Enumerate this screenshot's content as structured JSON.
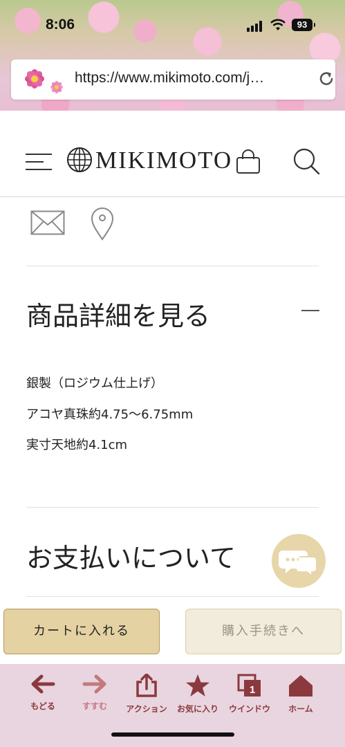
{
  "status_bar": {
    "time": "8:06",
    "battery": "93"
  },
  "browser": {
    "url": "https://www.mikimoto.com/j…"
  },
  "site": {
    "logo_text": "MIKIMOTO"
  },
  "product_detail": {
    "title": "商品詳細を見る",
    "lines": [
      "銀製（ロジウム仕上げ）",
      "アコヤ真珠約4.75〜6.75mm",
      "実寸天地約4.1cm"
    ]
  },
  "payment": {
    "title": "お支払いについて"
  },
  "actions": {
    "add_to_cart": "カートに入れる",
    "checkout": "購入手続きへ"
  },
  "toolbar": {
    "items": [
      {
        "label": "もどる",
        "icon": "arrow-left-icon"
      },
      {
        "label": "すすむ",
        "icon": "arrow-right-icon"
      },
      {
        "label": "アクション",
        "icon": "share-icon"
      },
      {
        "label": "お気に入り",
        "icon": "star-icon"
      },
      {
        "label": "ウインドウ",
        "icon": "tabs-icon",
        "badge": "1"
      },
      {
        "label": "ホーム",
        "icon": "home-icon"
      }
    ]
  },
  "colors": {
    "gold_button": "#e4d2a2",
    "toolbar_bg": "#e9d5df",
    "toolbar_icon": "#8a3a3e"
  }
}
